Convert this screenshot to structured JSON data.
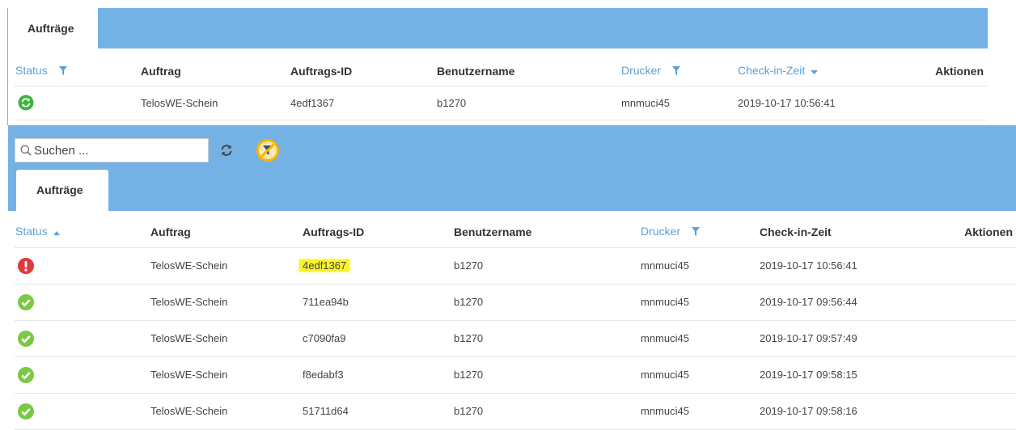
{
  "top_panel": {
    "tab_label": "Aufträge",
    "columns": {
      "status": "Status",
      "auftrag": "Auftrag",
      "auftrags_id": "Auftrags-ID",
      "benutzername": "Benutzername",
      "drucker": "Drucker",
      "checkin": "Check-in-Zeit",
      "aktionen": "Aktionen"
    },
    "rows": [
      {
        "status": "processing",
        "auftrag": "TelosWE-Schein",
        "auftrags_id": "4edf1367",
        "benutzername": "b1270",
        "drucker": "mnmuci45",
        "checkin": "2019-10-17 10:56:41"
      }
    ]
  },
  "bottom_panel": {
    "search_placeholder": "Suchen ...",
    "tab_label": "Aufträge",
    "columns": {
      "status": "Status",
      "auftrag": "Auftrag",
      "auftrags_id": "Auftrags-ID",
      "benutzername": "Benutzername",
      "drucker": "Drucker",
      "checkin": "Check-in-Zeit",
      "aktionen": "Aktionen"
    },
    "rows": [
      {
        "status": "error",
        "auftrag": "TelosWE-Schein",
        "auftrags_id": "4edf1367",
        "benutzername": "b1270",
        "drucker": "mnmuci45",
        "checkin": "2019-10-17 10:56:41"
      },
      {
        "status": "success",
        "auftrag": "TelosWE-Schein",
        "auftrags_id": "711ea94b",
        "benutzername": "b1270",
        "drucker": "mnmuci45",
        "checkin": "2019-10-17 09:56:44"
      },
      {
        "status": "success",
        "auftrag": "TelosWE-Schein",
        "auftrags_id": "c7090fa9",
        "benutzername": "b1270",
        "drucker": "mnmuci45",
        "checkin": "2019-10-17 09:57:49"
      },
      {
        "status": "success",
        "auftrag": "TelosWE-Schein",
        "auftrags_id": "f8edabf3",
        "benutzername": "b1270",
        "drucker": "mnmuci45",
        "checkin": "2019-10-17 09:58:15"
      },
      {
        "status": "success",
        "auftrag": "TelosWE-Schein",
        "auftrags_id": "51711d64",
        "benutzername": "b1270",
        "drucker": "mnmuci45",
        "checkin": "2019-10-17 09:58:16"
      }
    ]
  },
  "icons": {
    "filter": "filter-icon",
    "sort_down": "caret-down-icon",
    "sort_up": "caret-up-icon",
    "refresh": "refresh-icon",
    "clear_filter": "filter-off-icon",
    "search": "search-icon",
    "processing": "sync-status-icon",
    "error": "error-status-icon",
    "success": "check-status-icon"
  },
  "colors": {
    "tabbar": "#74b2e6",
    "link_blue": "#5aa1d8",
    "success": "#7ac943",
    "processing": "#3db43d",
    "error": "#e03a3a",
    "highlight": "#f9f22b",
    "clear_filter_ring": "#f7b500"
  }
}
